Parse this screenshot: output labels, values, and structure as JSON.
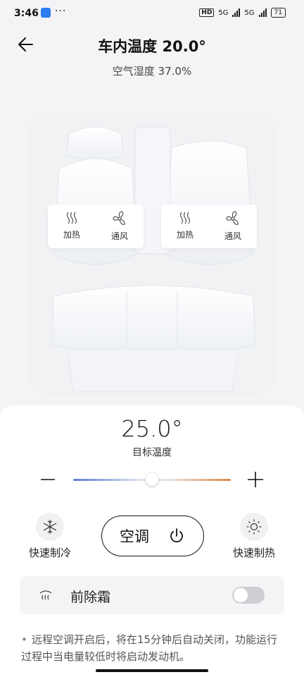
{
  "status_bar": {
    "time": "3:46",
    "dots": "···",
    "hd": "HD",
    "net1": "5G",
    "net2": "5G",
    "battery": "71"
  },
  "header": {
    "title": "车内温度 20.0°",
    "humidity": "空气湿度 37.0%"
  },
  "seats": {
    "front_left": {
      "heat_label": "加热",
      "vent_label": "通风"
    },
    "front_right": {
      "heat_label": "加热",
      "vent_label": "通风"
    }
  },
  "climate": {
    "target_temp": "25.0°",
    "target_label": "目标温度",
    "slider_level": 0.5,
    "quick_cool_label": "快速制冷",
    "ac_label": "空调",
    "quick_heat_label": "快速制热"
  },
  "defrost": {
    "label": "前除霜",
    "enabled": false
  },
  "note": "远程空调开启后，将在15分钟后自动关闭，功能运行过程中当电量较低时将启动发动机。",
  "colors": {
    "slider_cold": "#5a7fd6",
    "slider_hot": "#e08a4a",
    "panel_bg": "#ffffff",
    "page_bg": "#f4f4f6"
  }
}
